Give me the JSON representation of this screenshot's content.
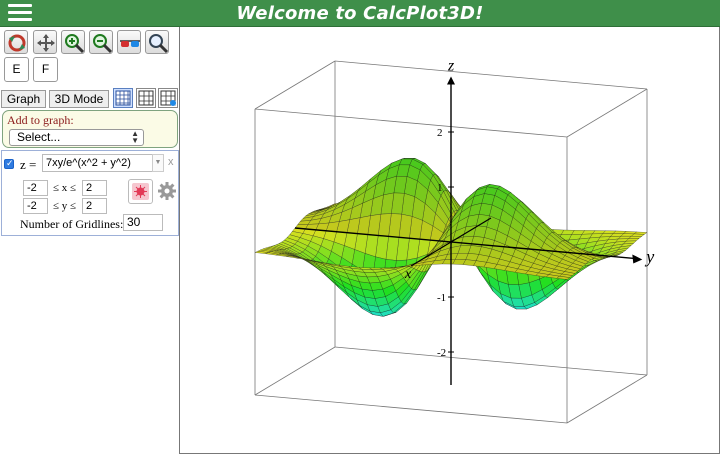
{
  "header": {
    "title": "Welcome to CalcPlot3D!"
  },
  "toolbar": {
    "tools": [
      {
        "name": "rotate-icon"
      },
      {
        "name": "move-icon"
      },
      {
        "name": "zoom-in-icon"
      },
      {
        "name": "zoom-out-icon"
      },
      {
        "name": "3d-glasses-icon"
      },
      {
        "name": "magnifier-icon"
      }
    ],
    "e_label": "E",
    "f_label": "F"
  },
  "tabs": {
    "graph": "Graph",
    "mode": "3D Mode"
  },
  "add_to_graph": {
    "label": "Add to graph:",
    "selected": "Select..."
  },
  "function": {
    "z_label": "z =",
    "expression": "7xy/e^(x^2 + y^2)",
    "close": "x",
    "x_min": "-2",
    "x_label": "≤ x ≤",
    "x_max": "2",
    "y_min": "-2",
    "y_label": "≤ y ≤",
    "y_max": "2",
    "gridlines_label": "Number of Gridlines:",
    "gridlines_value": "30"
  },
  "plot": {
    "axis_labels": {
      "x": "x",
      "y": "y",
      "z": "z"
    },
    "z_ticks": [
      "2",
      "1",
      "-1",
      "-2"
    ]
  },
  "colors": {
    "header": "#3f8f4a",
    "panel_border": "#7fa37f"
  }
}
